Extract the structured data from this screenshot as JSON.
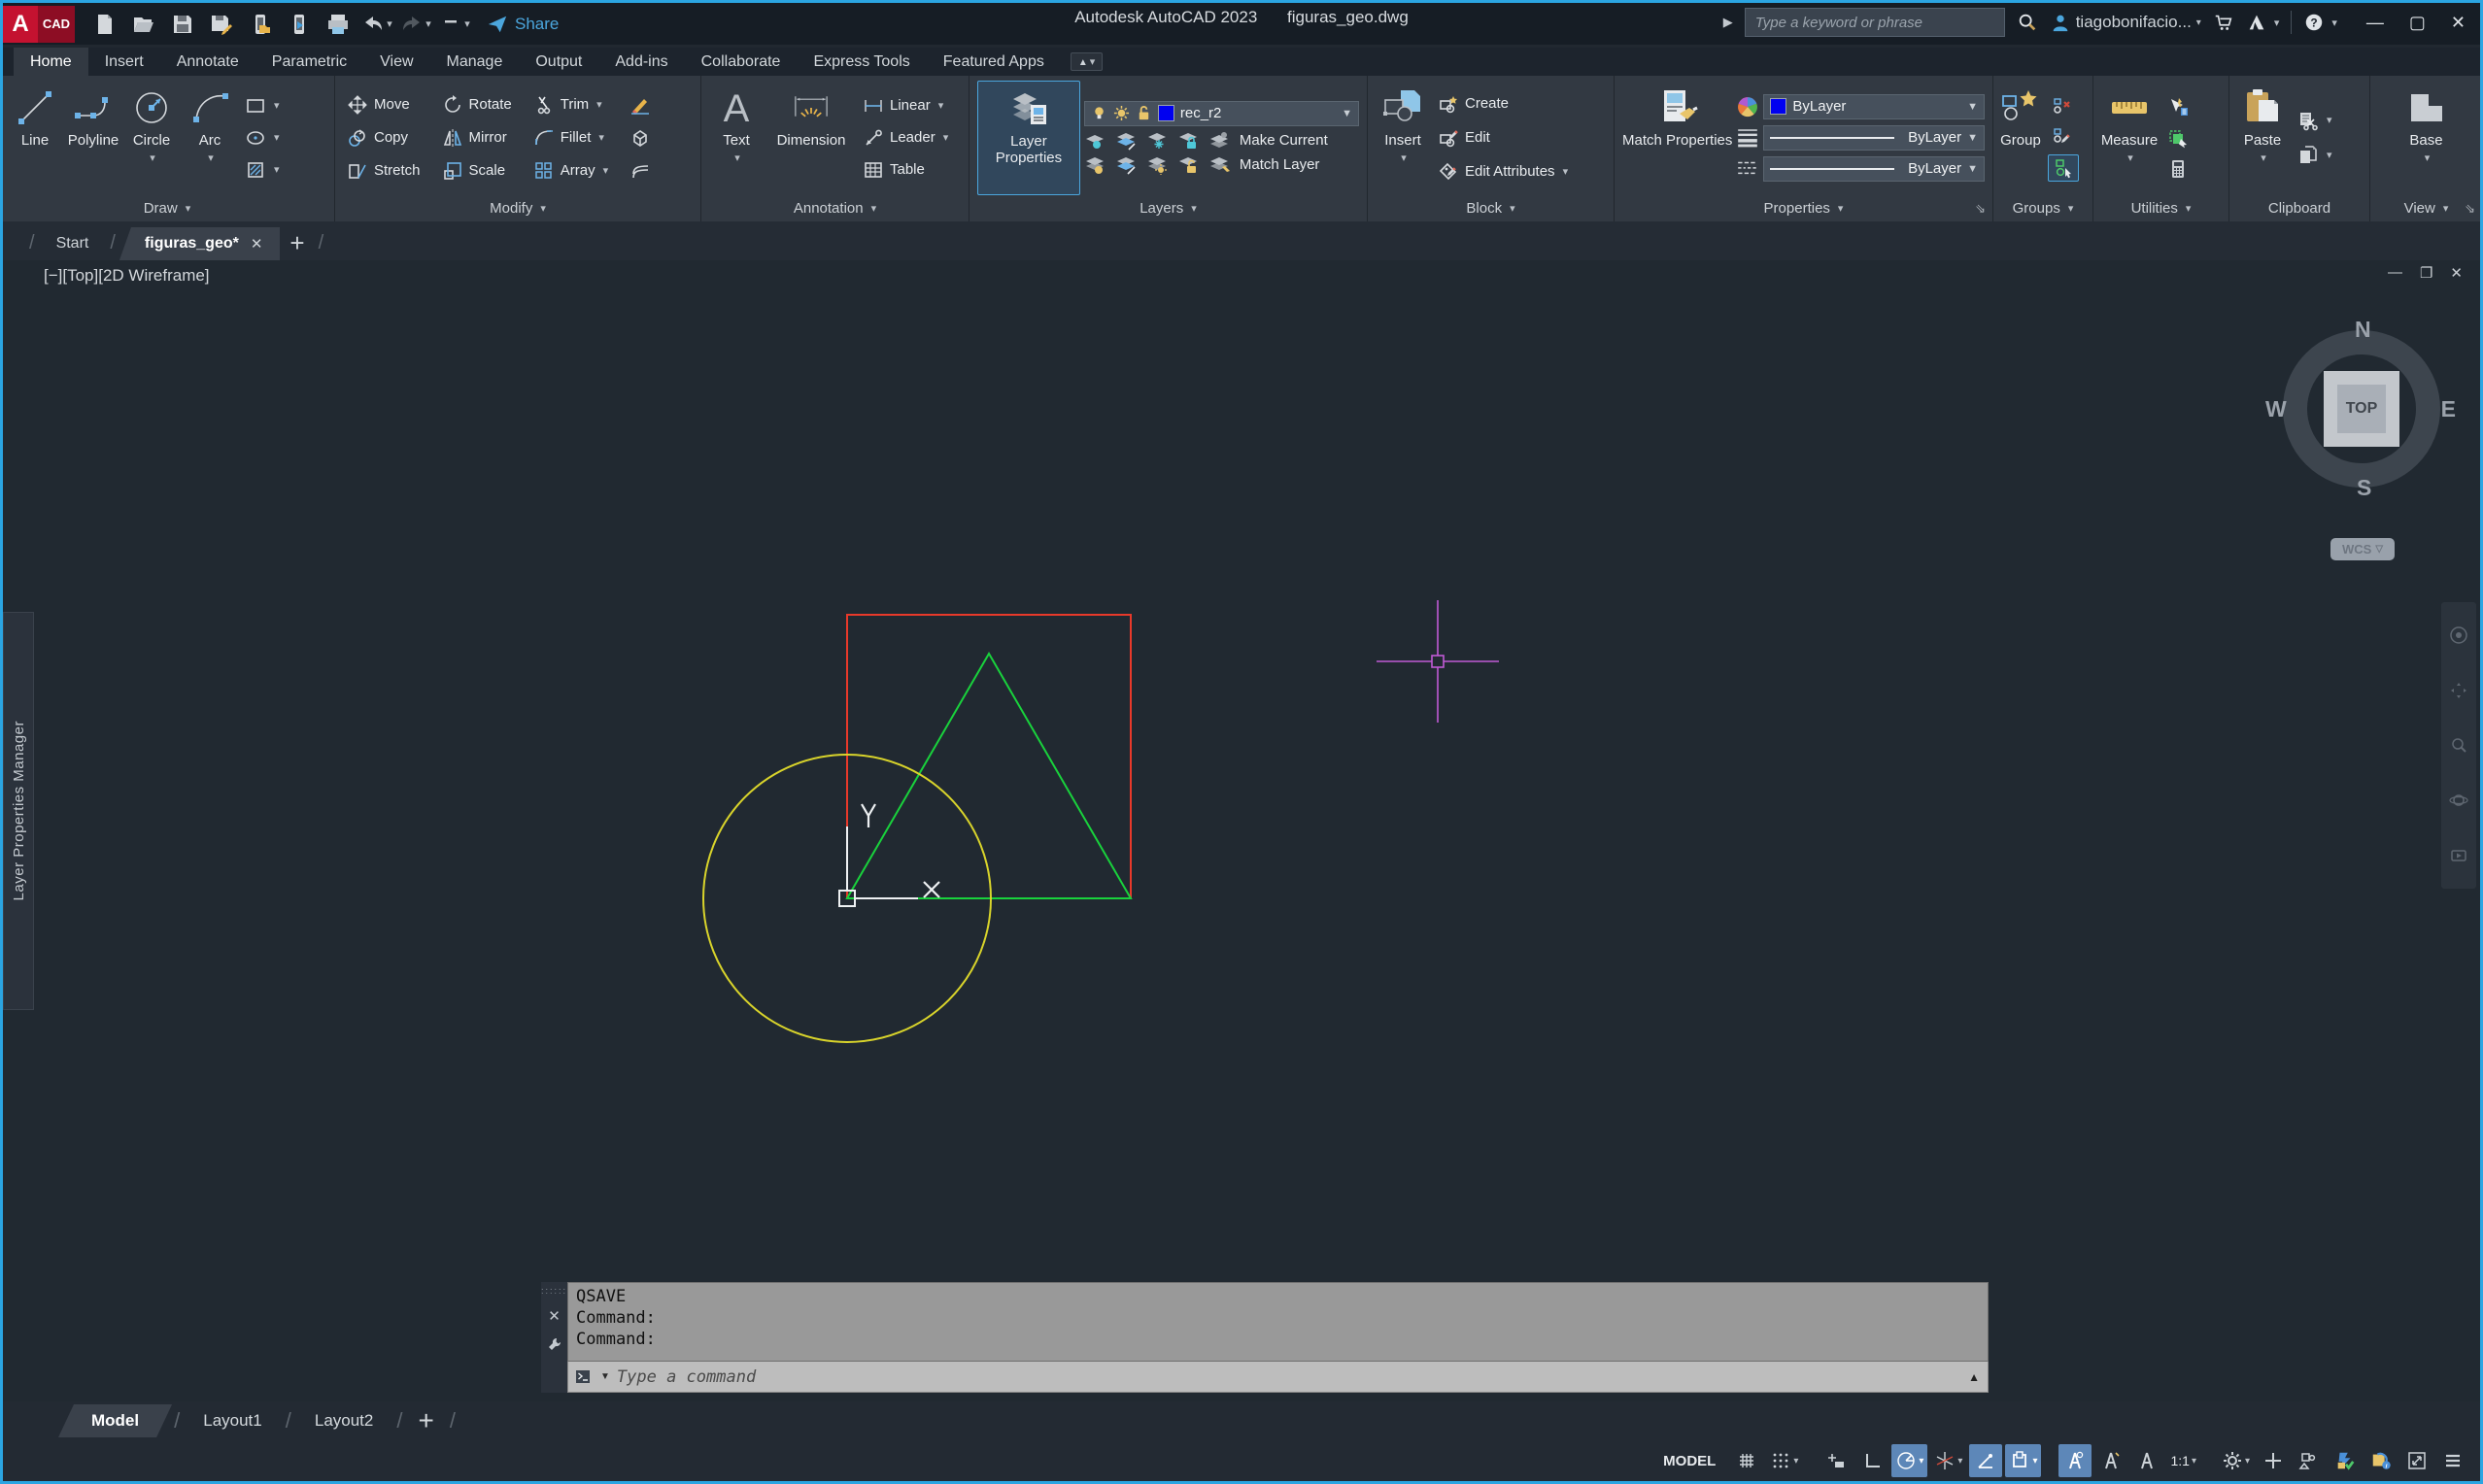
{
  "titlebar": {
    "app_title": "Autodesk AutoCAD 2023",
    "doc_title": "figuras_geo.dwg",
    "share_label": "Share",
    "search_placeholder": "Type a keyword or phrase",
    "username": "tiagobonifacio...",
    "logo_a": "A",
    "logo_cad": "CAD",
    "help_glyph": "?"
  },
  "ribbon_tabs": {
    "items": [
      {
        "label": "Home"
      },
      {
        "label": "Insert"
      },
      {
        "label": "Annotate"
      },
      {
        "label": "Parametric"
      },
      {
        "label": "View"
      },
      {
        "label": "Manage"
      },
      {
        "label": "Output"
      },
      {
        "label": "Add-ins"
      },
      {
        "label": "Collaborate"
      },
      {
        "label": "Express Tools"
      },
      {
        "label": "Featured Apps"
      }
    ]
  },
  "draw_panel": {
    "label": "Draw",
    "line": "Line",
    "polyline": "Polyline",
    "circle": "Circle",
    "arc": "Arc"
  },
  "modify_panel": {
    "label": "Modify",
    "move": "Move",
    "rotate": "Rotate",
    "trim": "Trim",
    "copy": "Copy",
    "mirror": "Mirror",
    "fillet": "Fillet",
    "stretch": "Stretch",
    "scale": "Scale",
    "array": "Array"
  },
  "annotation_panel": {
    "label": "Annotation",
    "text": "Text",
    "dimension": "Dimension",
    "linear": "Linear",
    "leader": "Leader",
    "table": "Table"
  },
  "layers_panel": {
    "label": "Layers",
    "layer_properties": "Layer Properties",
    "current_layer": "rec_r2",
    "make_current": "Make Current",
    "match_layer": "Match Layer"
  },
  "block_panel": {
    "label": "Block",
    "insert": "Insert",
    "create": "Create",
    "edit": "Edit",
    "edit_attributes": "Edit Attributes"
  },
  "properties_panel": {
    "label": "Properties",
    "match_properties": "Match Properties",
    "color_value": "ByLayer",
    "lineweight_value": "ByLayer",
    "linetype_value": "ByLayer"
  },
  "groups_panel": {
    "label": "Groups",
    "group": "Group"
  },
  "utilities_panel": {
    "label": "Utilities",
    "measure": "Measure"
  },
  "clipboard_panel": {
    "label": "Clipboard",
    "paste": "Paste"
  },
  "view_panel": {
    "label": "View",
    "base": "Base"
  },
  "file_tabs": {
    "start": "Start",
    "doc": "figuras_geo*"
  },
  "viewport": {
    "vp_minus": "[−]",
    "vp_view": "[Top]",
    "vp_visual": "[2D Wireframe]",
    "cube_n": "N",
    "cube_s": "S",
    "cube_e": "E",
    "cube_w": "W",
    "cube_top": "TOP",
    "wcs": "WCS"
  },
  "left_palette": {
    "label": "Layer Properties Manager"
  },
  "drawing": {
    "shapes": [
      {
        "name": "rectangle",
        "color": "#e8392a"
      },
      {
        "name": "triangle",
        "color": "#19d23c"
      },
      {
        "name": "circle",
        "color": "#d9d42b"
      }
    ],
    "crosshair_color": "#c05ad6",
    "ucs_x_label": "X",
    "ucs_y_label": "Y"
  },
  "command_line": {
    "history": [
      "QSAVE",
      "Command:",
      "Command:"
    ],
    "placeholder": "Type a command"
  },
  "layout_tabs": {
    "model": "Model",
    "layout1": "Layout1",
    "layout2": "Layout2"
  },
  "statusbar": {
    "model": "MODEL",
    "scale": "1:1"
  },
  "colors": {
    "accent_blue": "#2ba5e2",
    "active_toggle": "#5d87b8",
    "layer_swatch": "#0000f0"
  }
}
